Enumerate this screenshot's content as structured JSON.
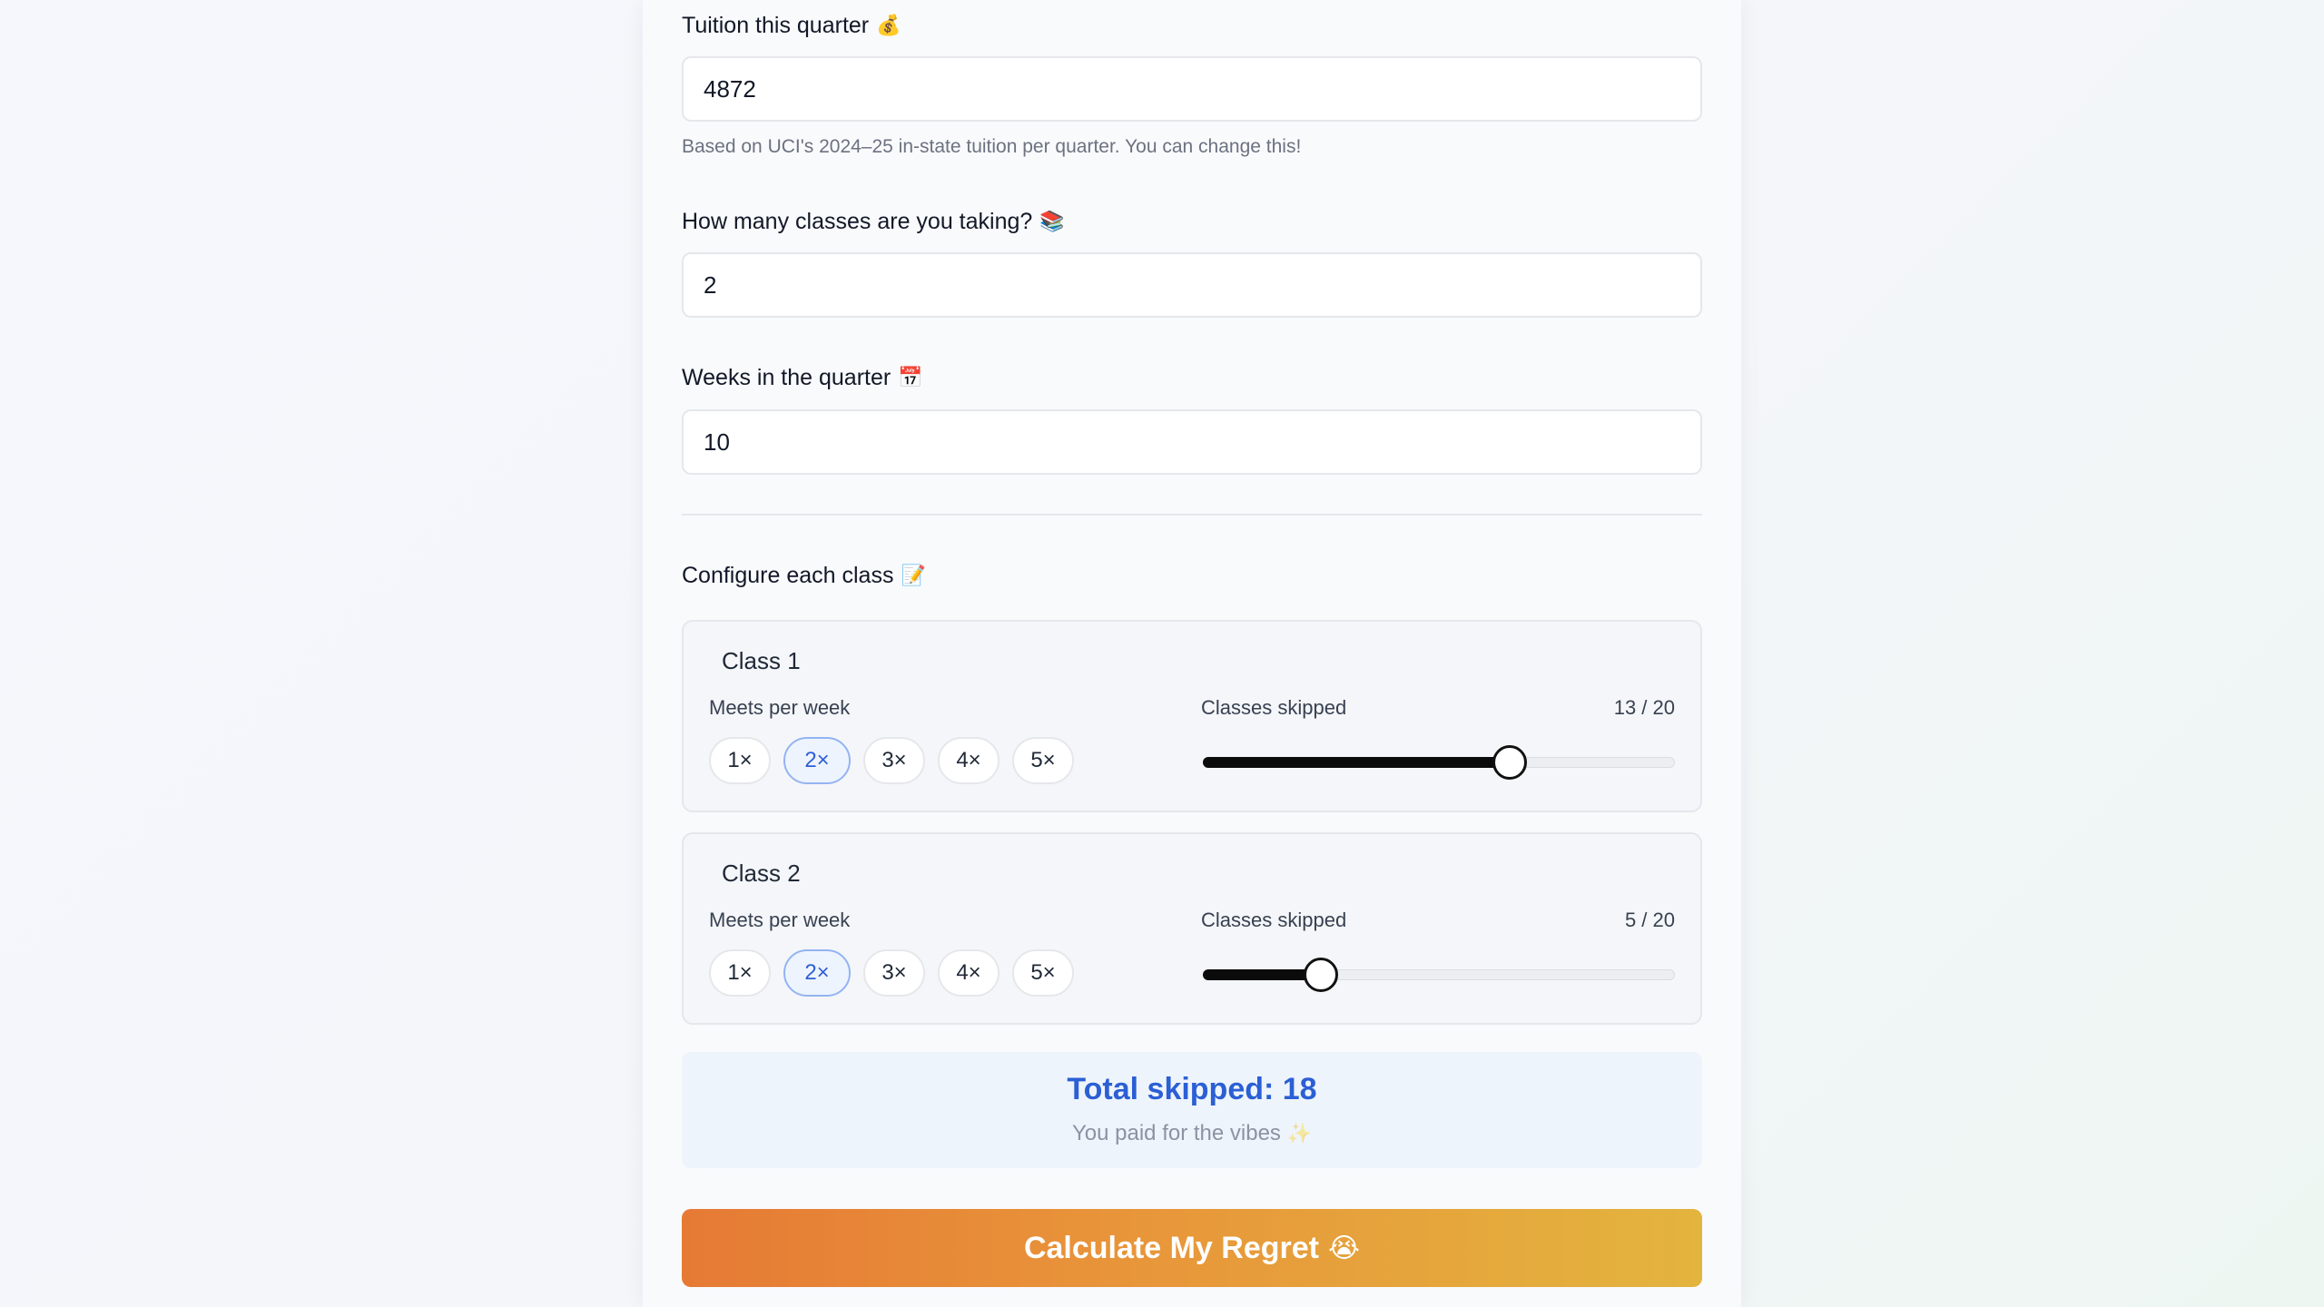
{
  "form": {
    "tuition": {
      "label": "Tuition this quarter",
      "icon": "money-bag-icon",
      "emoji": "💰",
      "value": "4872",
      "helper": "Based on UCI's 2024–25 in-state tuition per quarter. You can change this!"
    },
    "classes": {
      "label": "How many classes are you taking?",
      "icon": "books-icon",
      "emoji": "📚",
      "value": "2"
    },
    "weeks": {
      "label": "Weeks in the quarter",
      "icon": "calendar-icon",
      "emoji": "📅",
      "value": "10"
    }
  },
  "configure": {
    "title": "Configure each class",
    "icon": "memo-icon",
    "emoji": "📝",
    "meets_label": "Meets per week",
    "skipped_label": "Classes skipped",
    "freq_options": [
      "1×",
      "2×",
      "3×",
      "4×",
      "5×"
    ],
    "classes": [
      {
        "title": "Class 1",
        "selected_freq": "2×",
        "skipped": 13,
        "total": 20,
        "count_text": "13 / 20"
      },
      {
        "title": "Class 2",
        "selected_freq": "2×",
        "skipped": 5,
        "total": 20,
        "count_text": "5 / 20"
      }
    ]
  },
  "summary": {
    "title": "Total skipped: 18",
    "subtitle": "You paid for the vibes",
    "emoji": "✨",
    "icon": "sparkles-icon"
  },
  "cta": {
    "label": "Calculate My Regret",
    "emoji": "😭",
    "icon": "crying-face-icon",
    "gradient": [
      "#e67a35",
      "#e3b43e"
    ]
  },
  "colors": {
    "accent_blue": "#2b5fd4",
    "slider_fill": "#0b0b0b"
  }
}
